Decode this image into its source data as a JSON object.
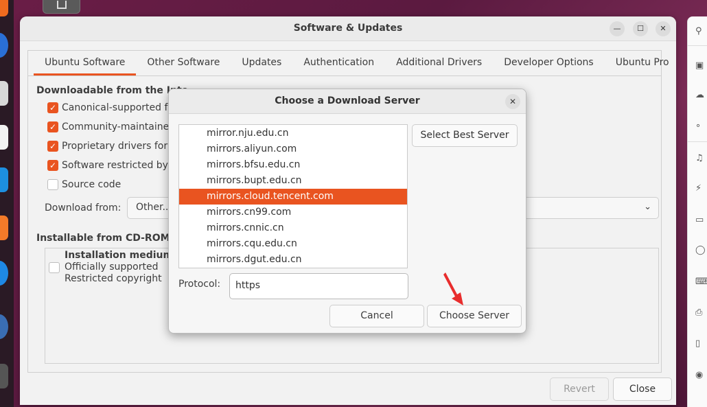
{
  "main_window": {
    "title": "Software & Updates",
    "tabs": [
      "Ubuntu Software",
      "Other Software",
      "Updates",
      "Authentication",
      "Additional Drivers",
      "Developer Options",
      "Ubuntu Pro"
    ],
    "active_tab": "Ubuntu Software",
    "downloadable_section": "Downloadable from the Inte",
    "checkboxes": [
      {
        "label": "Canonical-supported fr",
        "checked": true
      },
      {
        "label": "Community-maintained",
        "checked": true
      },
      {
        "label": "Proprietary drivers for",
        "checked": true
      },
      {
        "label": "Software restricted by c",
        "checked": true
      },
      {
        "label": "Source code",
        "checked": false
      }
    ],
    "download_from_label": "Download from:",
    "download_from_value": "Other...",
    "installable_section": "Installable from CD-ROM/D",
    "cdrom": {
      "line1": "Installation medium v",
      "line2": "Officially supported",
      "line3": "Restricted copyright",
      "checked": false
    },
    "revert_label": "Revert",
    "close_label": "Close"
  },
  "dialog": {
    "title": "Choose a Download Server",
    "servers": [
      "mirror.nju.edu.cn",
      "mirrors.aliyun.com",
      "mirrors.bfsu.edu.cn",
      "mirrors.bupt.edu.cn",
      "mirrors.cloud.tencent.com",
      "mirrors.cn99.com",
      "mirrors.cnnic.cn",
      "mirrors.cqu.edu.cn",
      "mirrors.dgut.edu.cn"
    ],
    "selected_server": "mirrors.cloud.tencent.com",
    "select_best_label": "Select Best Server",
    "protocol_label": "Protocol:",
    "protocol_value": "https",
    "cancel_label": "Cancel",
    "choose_label": "Choose Server"
  },
  "side_panel_icons": [
    "search-icon",
    "lock-icon",
    "cloud-icon",
    "share-icon",
    "music-icon",
    "power-icon",
    "display-icon",
    "mouse-icon",
    "keyboard-icon",
    "printer-icon",
    "usb-icon",
    "color-icon"
  ],
  "colors": {
    "accent": "#e95420",
    "arrow": "#e82d2d"
  }
}
